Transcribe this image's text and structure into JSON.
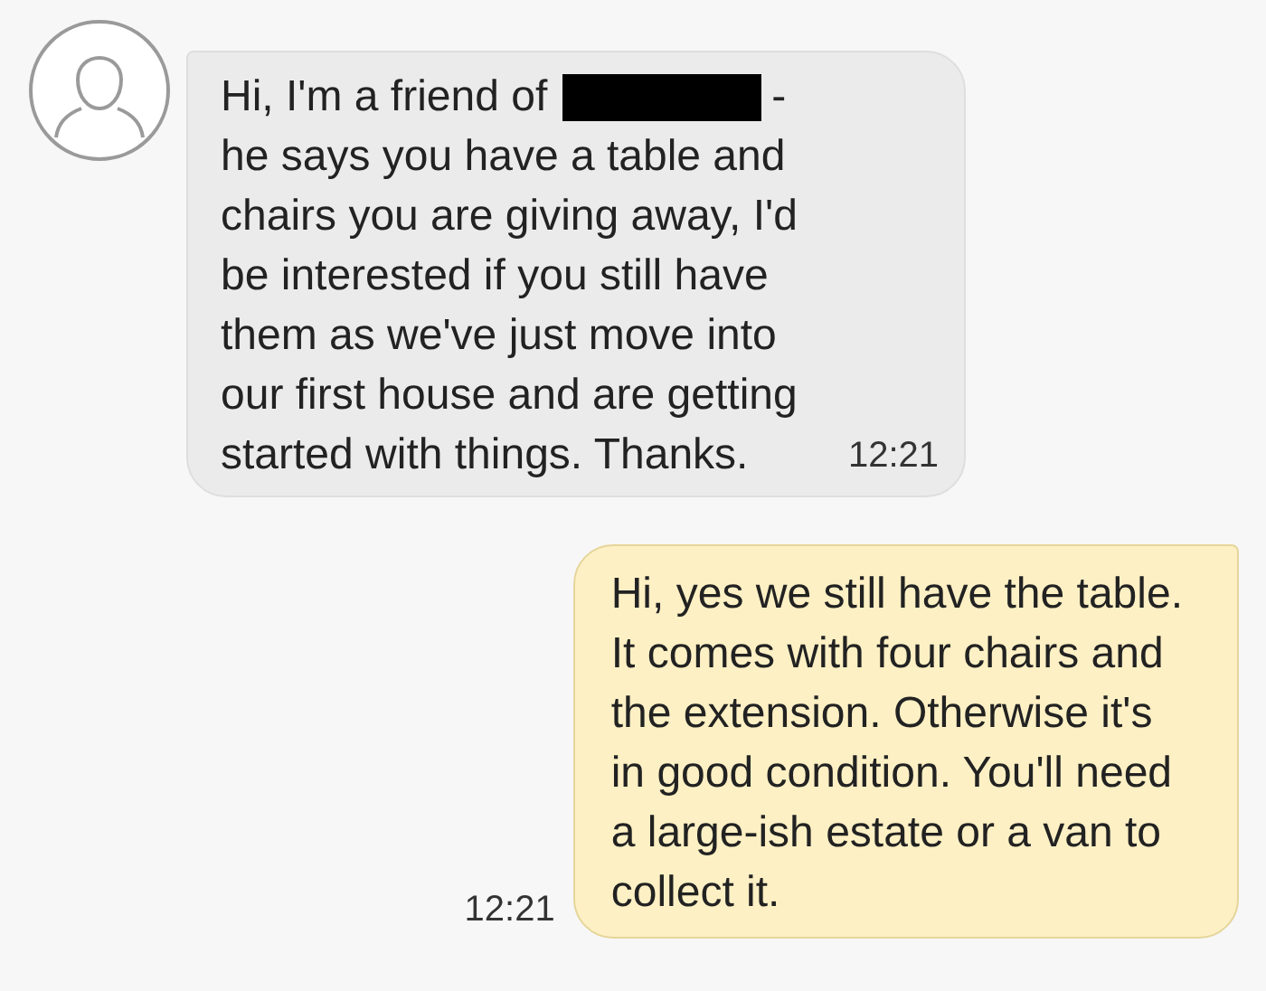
{
  "messages": [
    {
      "kind": "incoming",
      "first_line_start": "Hi, I'm a friend of",
      "redacted": true,
      "first_line_end": "-",
      "text": "he says you have a table and\nchairs you are giving away, I'd\nbe interested if you still have\nthem as we've just move into\nour first house and are getting\nstarted with things. Thanks.",
      "time": "12:21"
    },
    {
      "kind": "outgoing",
      "text": "Hi, yes we still have the table.\nIt comes with four chairs and\nthe extension. Otherwise it's\nin good condition. You'll need\na large-ish estate or a van to\ncollect it.",
      "time": "12:21"
    }
  ]
}
